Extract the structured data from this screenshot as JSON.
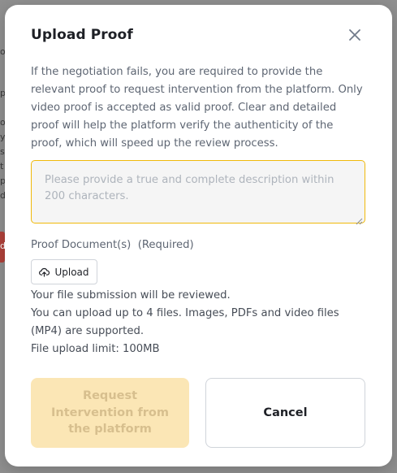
{
  "background": {
    "fragments": [
      "o",
      "p",
      "o",
      "yo",
      "se",
      "t",
      "p",
      "d"
    ],
    "red_button_text": "d"
  },
  "modal": {
    "title": "Upload Proof",
    "close_icon": "close-icon",
    "description": "If the negotiation fails, you are required to provide the relevant proof to request intervention from the platform. Only video proof is accepted as valid proof. Clear and detailed proof will help the platform verify the authenticity of the proof, which will speed up the review process.",
    "textarea": {
      "placeholder": "Please provide a true and complete description within 200 characters.",
      "value": ""
    },
    "proof_label": "Proof Document(s)  (Required)",
    "upload": {
      "icon": "upload-cloud-icon",
      "label": "Upload"
    },
    "info_lines": [
      "Your file submission will be reviewed.",
      "You can upload up to 4 files. Images, PDFs and video files (MP4) are supported.",
      "File upload limit: 100MB"
    ],
    "request_button": "Request Intervention from the platform",
    "cancel_button": "Cancel"
  },
  "colors": {
    "accent": "#f0b90b",
    "primary_disabled_bg": "#fbe6b5",
    "primary_disabled_text": "#d7bf8e",
    "title_text": "#1e2026",
    "body_text": "#5e6673"
  }
}
